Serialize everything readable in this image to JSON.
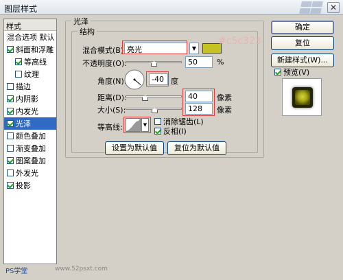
{
  "window": {
    "title": "图层样式"
  },
  "left_panel": {
    "header": "样式",
    "items": [
      {
        "label": "混合选项 默认",
        "checkbox": false,
        "checked": false,
        "indent": false
      },
      {
        "label": "斜面和浮雕",
        "checkbox": true,
        "checked": true,
        "indent": false
      },
      {
        "label": "等高线",
        "checkbox": true,
        "checked": true,
        "indent": true
      },
      {
        "label": "纹理",
        "checkbox": true,
        "checked": false,
        "indent": true
      },
      {
        "label": "描边",
        "checkbox": true,
        "checked": false,
        "indent": false
      },
      {
        "label": "内阴影",
        "checkbox": true,
        "checked": true,
        "indent": false
      },
      {
        "label": "内发光",
        "checkbox": true,
        "checked": true,
        "indent": false
      },
      {
        "label": "光泽",
        "checkbox": true,
        "checked": true,
        "indent": false,
        "selected": true
      },
      {
        "label": "颜色叠加",
        "checkbox": true,
        "checked": false,
        "indent": false
      },
      {
        "label": "渐变叠加",
        "checkbox": true,
        "checked": false,
        "indent": false
      },
      {
        "label": "图案叠加",
        "checkbox": true,
        "checked": true,
        "indent": false
      },
      {
        "label": "外发光",
        "checkbox": true,
        "checked": false,
        "indent": false
      },
      {
        "label": "投影",
        "checkbox": true,
        "checked": true,
        "indent": false
      }
    ]
  },
  "satin": {
    "group_title": "光泽",
    "structure_title": "结构",
    "blend_mode_label": "混合模式(B):",
    "blend_mode_value": "亮光",
    "color_code": "#c5c323",
    "opacity_label": "不透明度(O):",
    "opacity_value": "50",
    "opacity_unit": "%",
    "opacity_level": 0.5,
    "angle_label": "角度(N):",
    "angle_value": "-40",
    "angle_unit": "度",
    "distance_label": "距离(D):",
    "distance_value": "40",
    "distance_unit": "像素",
    "size_label": "大小(S):",
    "size_value": "128",
    "size_unit": "像素",
    "contour_label": "等高线:",
    "antialias_label": "消除锯齿(L)",
    "antialias_checked": false,
    "invert_label": "反相(I)",
    "invert_checked": true,
    "set_default_label": "设置为默认值",
    "reset_default_label": "复位为默认值"
  },
  "right_buttons": {
    "ok": "确定",
    "reset": "复位",
    "new_style": "新建样式(W)...",
    "preview_label": "预览(V)",
    "preview_checked": true
  },
  "watermark": {
    "left": "PS学堂",
    "site": "www.52psxt.com"
  },
  "colors": {
    "swatch": "#c5c323",
    "highlight": "#e23c3c",
    "selection": "#316ac5"
  }
}
